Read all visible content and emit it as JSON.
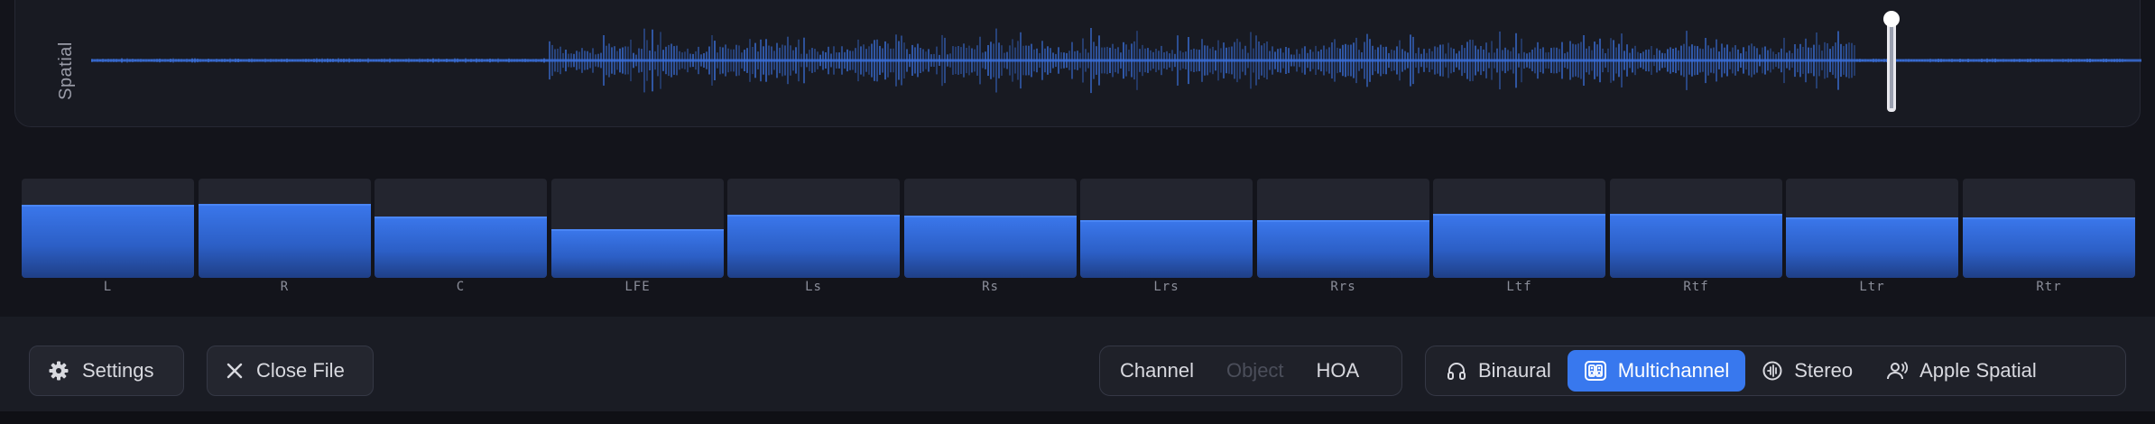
{
  "waveform": {
    "label": "Spatial",
    "color": "#3a6fd8",
    "playhead_color": "#ffffff"
  },
  "meters": [
    {
      "label": "L",
      "level": 0.74
    },
    {
      "label": "R",
      "level": 0.75
    },
    {
      "label": "C",
      "level": 0.62
    },
    {
      "label": "LFE",
      "level": 0.49
    },
    {
      "label": "Ls",
      "level": 0.64
    },
    {
      "label": "Rs",
      "level": 0.63
    },
    {
      "label": "Lrs",
      "level": 0.58
    },
    {
      "label": "Rrs",
      "level": 0.58
    },
    {
      "label": "Ltf",
      "level": 0.65
    },
    {
      "label": "Rtf",
      "level": 0.65
    },
    {
      "label": "Ltr",
      "level": 0.61
    },
    {
      "label": "Rtr",
      "level": 0.61
    }
  ],
  "toolbar": {
    "settings_label": "Settings",
    "close_label": "Close File",
    "format_tabs": [
      {
        "label": "Channel",
        "state": "normal"
      },
      {
        "label": "Object",
        "state": "disabled"
      },
      {
        "label": "HOA",
        "state": "normal"
      }
    ],
    "output_tabs": [
      {
        "label": "Binaural",
        "icon": "headphones-icon",
        "state": "normal"
      },
      {
        "label": "Multichannel",
        "icon": "speakers-icon",
        "state": "active"
      },
      {
        "label": "Stereo",
        "icon": "stereo-icon",
        "state": "normal"
      },
      {
        "label": "Apple Spatial",
        "icon": "spatial-person-icon",
        "state": "normal"
      }
    ]
  }
}
